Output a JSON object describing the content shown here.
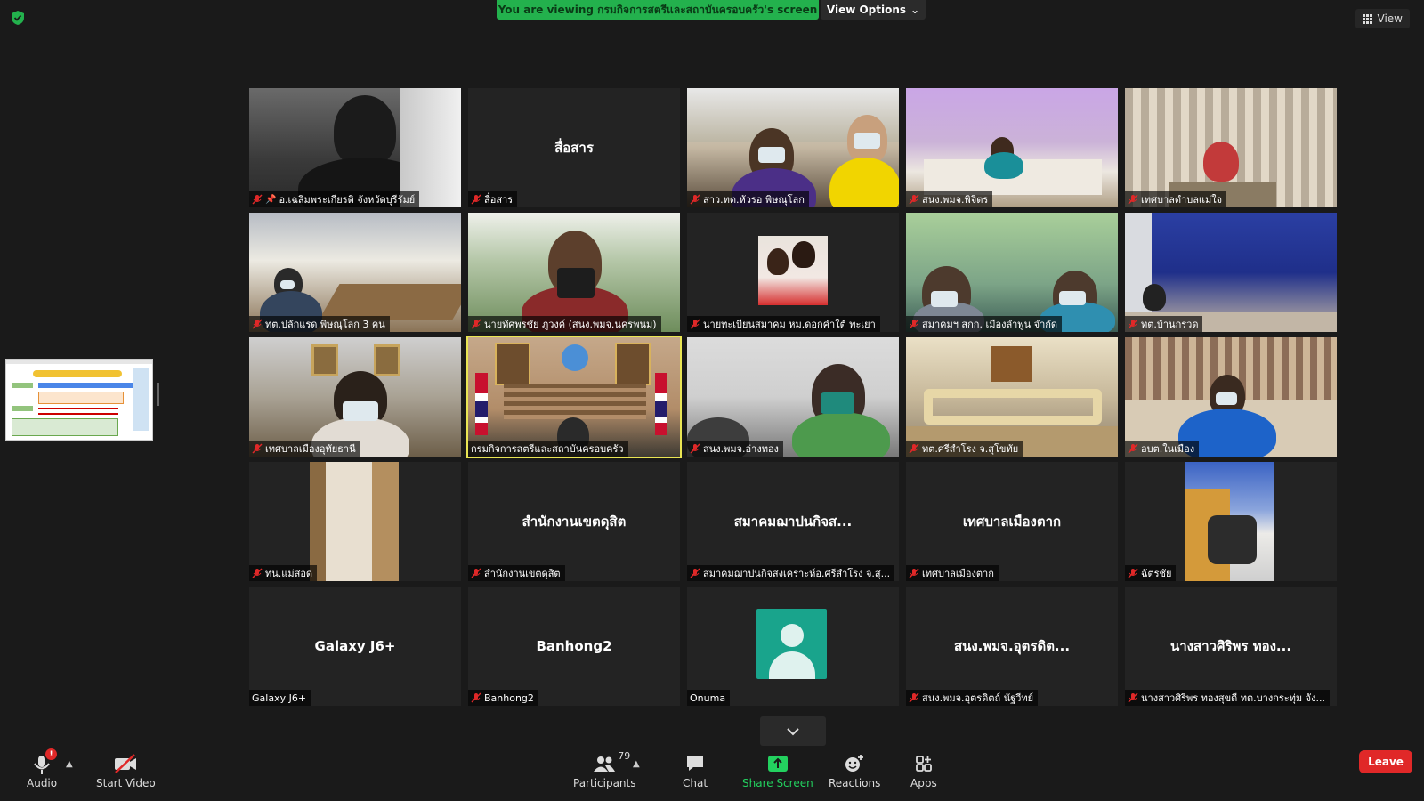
{
  "topbar": {
    "banner_prefix": "You are viewing ",
    "banner_name": "กรมกิจการสตรีและสถาบันครอบครัว",
    "banner_suffix": "'s screen",
    "view_options": "View Options",
    "view": "View"
  },
  "gallery": {
    "tiles": [
      {
        "label": "อ.เฉลิมพระเกียรติ จังหวัดบุรีรัมย์",
        "big": "",
        "muted": true,
        "pinned": true
      },
      {
        "label": "สื่อสาร",
        "big": "สื่อสาร",
        "muted": true,
        "pinned": false
      },
      {
        "label": "สาว.ทต.หัวรอ พิษณุโลก",
        "big": "",
        "muted": true,
        "pinned": false
      },
      {
        "label": "สนง.พมจ.พิจิตร",
        "big": "",
        "muted": true,
        "pinned": false
      },
      {
        "label": "เทศบาลตำบลแม่ใจ",
        "big": "",
        "muted": true,
        "pinned": false
      },
      {
        "label": "ทต.ปลักแรด พิษณุโลก 3 คน",
        "big": "",
        "muted": true,
        "pinned": false
      },
      {
        "label": "นายทัศพรชัย  ภูวงค์ (สนง.พมจ.นครพนม)",
        "big": "",
        "muted": true,
        "pinned": false
      },
      {
        "label": "นายทะเบียนสมาคม หม.ดอกคำใต้ พะเยา",
        "big": "",
        "muted": true,
        "pinned": false
      },
      {
        "label": "สมาคมฯ สกก. เมืองลำพูน จำกัด",
        "big": "",
        "muted": true,
        "pinned": false
      },
      {
        "label": "ทต.บ้านกรวด",
        "big": "",
        "muted": true,
        "pinned": false
      },
      {
        "label": "เทศบาลเมืองอุทัยธานี",
        "big": "",
        "muted": true,
        "pinned": false
      },
      {
        "label": "กรมกิจการสตรีและสถาบันครอบครัว",
        "big": "",
        "muted": false,
        "pinned": false
      },
      {
        "label": "สนง.พมจ.อ่างทอง",
        "big": "",
        "muted": true,
        "pinned": false
      },
      {
        "label": "ทต.ศรีสำโรง จ.สุโขทัย",
        "big": "",
        "muted": true,
        "pinned": false
      },
      {
        "label": "อบต.ในเมือง",
        "big": "",
        "muted": true,
        "pinned": false
      },
      {
        "label": "ทน.แม่สอด",
        "big": "",
        "muted": true,
        "pinned": false
      },
      {
        "label": "สำนักงานเขตดุสิต",
        "big": "สำนักงานเขตดุสิต",
        "muted": true,
        "pinned": false
      },
      {
        "label": "สมาคมฌาปนกิจสงเคราะห์อ.ศรีสำโรง จ.สุ...",
        "big": "สมาคมฌาปนกิจส...",
        "muted": true,
        "pinned": false
      },
      {
        "label": "เทศบาลเมืองตาก",
        "big": "เทศบาลเมืองตาก",
        "muted": true,
        "pinned": false
      },
      {
        "label": "ฉัตรชัย",
        "big": "",
        "muted": true,
        "pinned": false
      },
      {
        "label": "Galaxy J6+",
        "big": "Galaxy J6+",
        "muted": false,
        "pinned": false
      },
      {
        "label": "Banhong2",
        "big": "Banhong2",
        "muted": true,
        "pinned": false
      },
      {
        "label": "Onuma",
        "big": "",
        "muted": false,
        "pinned": false
      },
      {
        "label": "สนง.พมจ.อุตรดิตถ์ นัฐวีทย์",
        "big": "สนง.พมจ.อุตรดิต...",
        "muted": true,
        "pinned": false
      },
      {
        "label": "นางสาวศิริพร ทองสุขดี ทต.บางกระทุ่ม จัง...",
        "big": "นางสาวศิริพร ทอง...",
        "muted": true,
        "pinned": false
      }
    ]
  },
  "toolbar": {
    "audio": "Audio",
    "audio_badge": "!",
    "start_video": "Start Video",
    "participants": "Participants",
    "participants_count": "79",
    "chat": "Chat",
    "share_screen": "Share Screen",
    "reactions": "Reactions",
    "apps": "Apps",
    "leave": "Leave"
  },
  "colors": {
    "banner": "#23b14d",
    "active_speaker": "#e9e553",
    "leave": "#e02828",
    "share": "#23d15f",
    "mute": "#e02828"
  }
}
